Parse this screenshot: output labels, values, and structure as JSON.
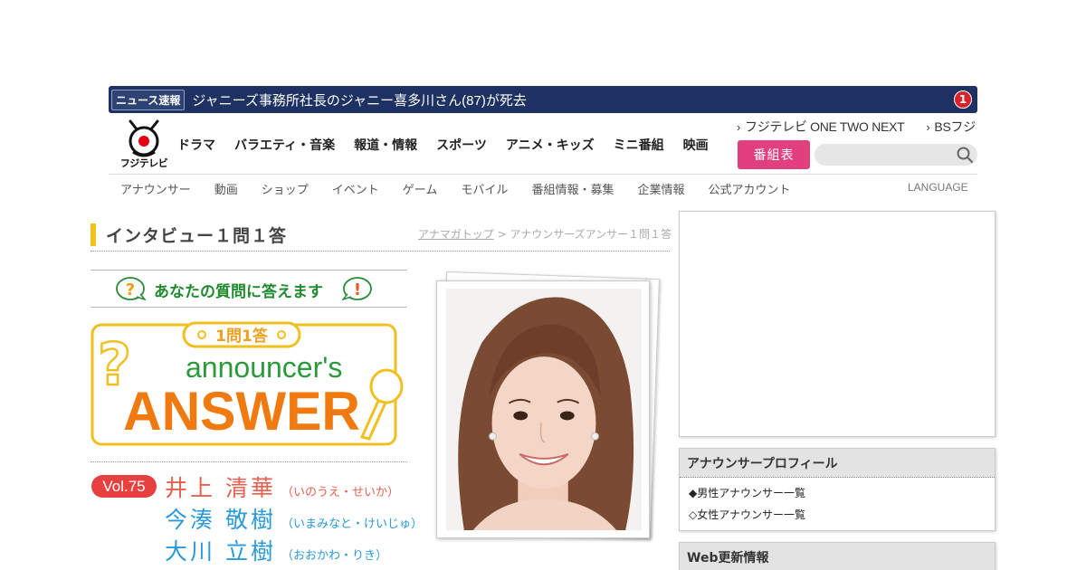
{
  "news": {
    "badge": "ニュース速報",
    "headline": "ジャニーズ事務所社長のジャニー喜多川さん(87)が死去",
    "count": "1"
  },
  "header": {
    "logo_text": "フジテレビ",
    "gnav": [
      "ドラマ",
      "バラエティ・音楽",
      "報道・情報",
      "スポーツ",
      "アニメ・キッズ",
      "ミニ番組",
      "映画"
    ],
    "toplinks": [
      "フジテレビ ONE TWO NEXT",
      "BSフジ"
    ],
    "bangumi_label": "番組表",
    "search_placeholder": ""
  },
  "subnav": {
    "items": [
      "アナウンサー",
      "動画",
      "ショップ",
      "イベント",
      "ゲーム",
      "モバイル",
      "番組情報・募集",
      "企業情報",
      "公式アカウント"
    ],
    "language": "LANGUAGE"
  },
  "main": {
    "title": "インタビュー１問１答",
    "breadcrumb_link": "アナマガトップ",
    "breadcrumb_sep": " > ",
    "breadcrumb_current": "アナウンサーズアンサー１問１答",
    "qa_text": "あなたの質問に答えます",
    "logo_tag": "1問1答",
    "logo_line1": "announcer's",
    "logo_line2": "ANSWER",
    "vol": "Vol.75",
    "announcers": [
      {
        "name": "井上 清華",
        "kana": "（いのうえ・せいか）",
        "color": "#e8604f"
      },
      {
        "name": "今湊 敬樹",
        "kana": "（いまみなと・けいじゅ）",
        "color": "#2a9ad8"
      },
      {
        "name": "大川 立樹",
        "kana": "（おおかわ・りき）",
        "color": "#2a9ad8"
      }
    ]
  },
  "sidebar": {
    "profile": {
      "title": "アナウンサープロフィール",
      "items": [
        "◆男性アナウンサー一覧",
        "◇女性アナウンサー一覧"
      ]
    },
    "web_update": {
      "title": "Web更新情報"
    }
  }
}
